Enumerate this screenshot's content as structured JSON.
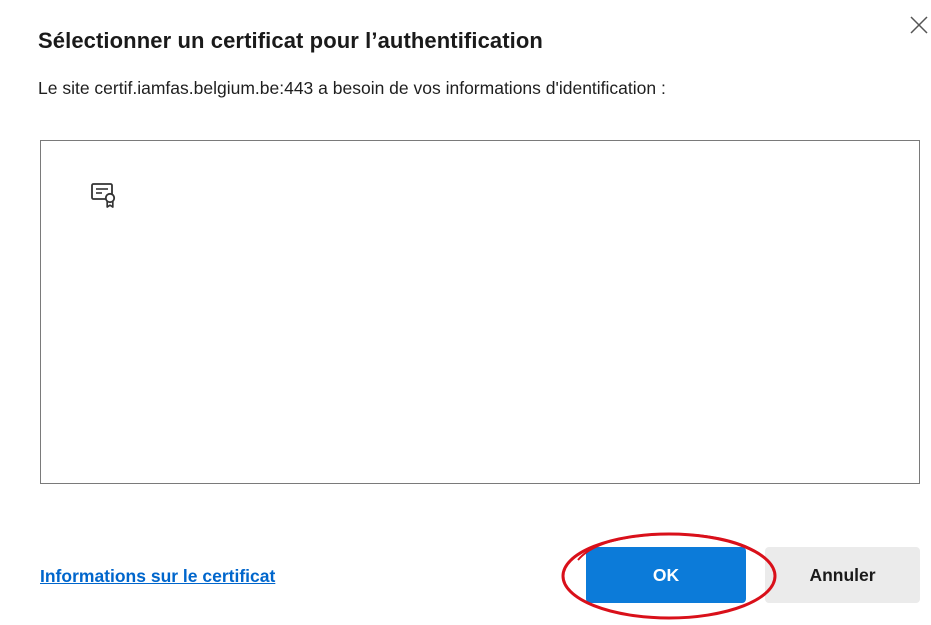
{
  "dialog": {
    "title": "Sélectionner un certificat pour l’authentification",
    "description": "Le site certif.iamfas.belgium.be:443 a besoin de vos informations d'identification :",
    "close_icon": "close-icon"
  },
  "certificates": {
    "items": [
      {
        "icon": "certificate-icon",
        "label": ""
      }
    ]
  },
  "footer": {
    "info_link": "Informations sur le certificat",
    "ok_label": "OK",
    "cancel_label": "Annuler",
    "ok_color": "#0c7bd9",
    "cancel_color": "#ebebeb",
    "link_color": "#0066cc",
    "annotation_color": "#d9101a"
  }
}
